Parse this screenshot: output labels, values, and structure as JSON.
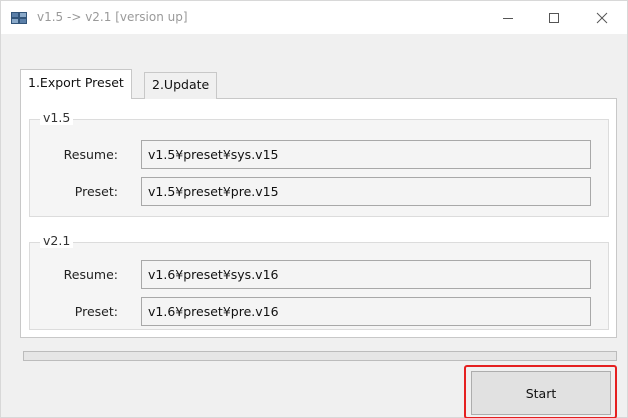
{
  "window": {
    "title": "v1.5 -> v2.1 [version up]",
    "icon": "app-window-icon"
  },
  "tabs": [
    {
      "label": "1.Export Preset",
      "active": true
    },
    {
      "label": "2.Update",
      "active": false
    }
  ],
  "groups": {
    "v15": {
      "legend": "v1.5",
      "resume_label": "Resume:",
      "resume_value": "v1.5¥preset¥sys.v15",
      "preset_label": "Preset:",
      "preset_value": "v1.5¥preset¥pre.v15"
    },
    "v21": {
      "legend": "v2.1",
      "resume_label": "Resume:",
      "resume_value": "v1.6¥preset¥sys.v16",
      "preset_label": "Preset:",
      "preset_value": "v1.6¥preset¥pre.v16"
    }
  },
  "progress": {
    "value": 0
  },
  "buttons": {
    "start_label": "Start"
  },
  "colors": {
    "highlight": "#e52020",
    "progress": "#06b025"
  }
}
